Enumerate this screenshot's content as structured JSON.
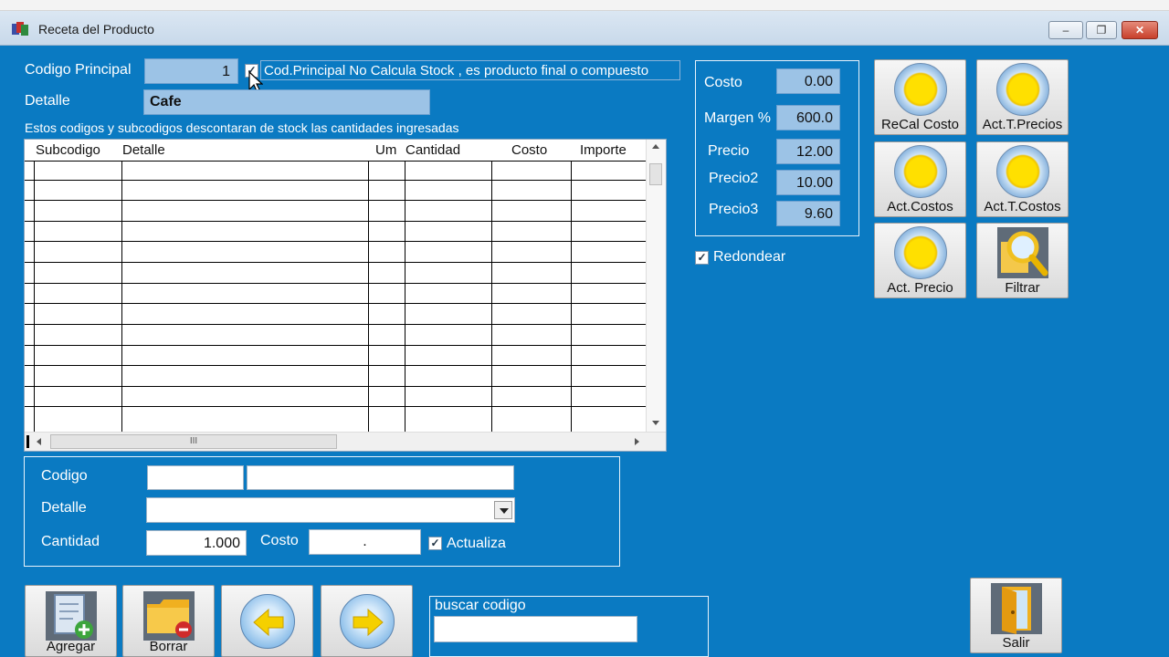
{
  "window": {
    "title": "Receta del Producto",
    "controls": [
      "–",
      "❐",
      "✕"
    ]
  },
  "header": {
    "codigo_label": "Codigo Principal",
    "codigo_value": "1",
    "no_calcula_label": "Cod.Principal No Calcula Stock , es producto final o compuesto",
    "detalle_label": "Detalle",
    "detalle_value": "Cafe",
    "info_text": "Estos codigos y subcodigos descontaran de stock las cantidades ingresadas"
  },
  "grid": {
    "columns": [
      "Subcodigo",
      "Detalle",
      "Um",
      "Cantidad",
      "Costo",
      "Importe"
    ],
    "rows": [],
    "hscroll_grip": "III"
  },
  "pricing": {
    "costo_label": "Costo",
    "costo_value": "0.00",
    "margen_label": "Margen %",
    "margen_value": "600.0",
    "precio_label": "Precio",
    "precio_value": "12.00",
    "precio2_label": "Precio2",
    "precio2_value": "10.00",
    "precio3_label": "Precio3",
    "precio3_value": "9.60",
    "redondear_label": "Redondear"
  },
  "actions": {
    "recal_costo": "ReCal Costo",
    "act_t_precios": "Act.T.Precios",
    "act_costos": "Act.Costos",
    "act_t_costos": "Act.T.Costos",
    "act_precio": "Act. Precio",
    "filtrar": "Filtrar"
  },
  "entry": {
    "codigo_label": "Codigo",
    "detalle_label": "Detalle",
    "cantidad_label": "Cantidad",
    "cantidad_value": "1.000",
    "costo_label": "Costo",
    "costo_value": ".",
    "actualiza_label": "Actualiza"
  },
  "bottom": {
    "agregar": "Agregar",
    "borrar": "Borrar",
    "buscar_label": "buscar codigo",
    "salir": "Salir"
  },
  "colors": {
    "background": "#0a7ac2",
    "field": "#9cc3e6"
  },
  "icons": [
    "app-icon",
    "mouse-cursor-icon",
    "add-document-icon",
    "delete-folder-icon",
    "arrow-left-icon",
    "arrow-right-icon",
    "search-magnifier-icon",
    "exit-door-icon"
  ]
}
